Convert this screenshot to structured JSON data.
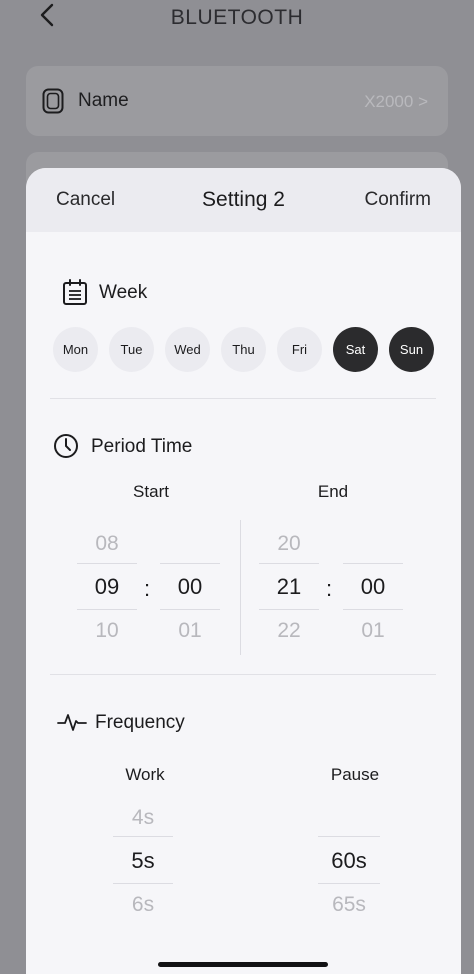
{
  "background": {
    "title": "BLUETOOTH",
    "name_row": {
      "label": "Name",
      "value": "X2000 >"
    }
  },
  "sheet": {
    "cancel_label": "Cancel",
    "title": "Setting 2",
    "confirm_label": "Confirm",
    "week": {
      "label": "Week",
      "days": [
        {
          "label": "Mon",
          "selected": false
        },
        {
          "label": "Tue",
          "selected": false
        },
        {
          "label": "Wed",
          "selected": false
        },
        {
          "label": "Thu",
          "selected": false
        },
        {
          "label": "Fri",
          "selected": false
        },
        {
          "label": "Sat",
          "selected": true
        },
        {
          "label": "Sun",
          "selected": true
        }
      ]
    },
    "period": {
      "label": "Period Time",
      "start_label": "Start",
      "end_label": "End",
      "separator": ":",
      "start_hour": [
        "08",
        "09",
        "10"
      ],
      "start_minute": [
        "",
        "00",
        "01"
      ],
      "end_hour": [
        "20",
        "21",
        "22"
      ],
      "end_minute": [
        "",
        "00",
        "01"
      ]
    },
    "frequency": {
      "label": "Frequency",
      "work_label": "Work",
      "pause_label": "Pause",
      "work": [
        "4s",
        "5s",
        "6s"
      ],
      "pause": [
        "",
        "60s",
        "65s"
      ]
    }
  },
  "colors": {
    "selected_day": "#2b2b2d",
    "overlay": "#8f8f94",
    "sheet": "#f6f6f9"
  }
}
